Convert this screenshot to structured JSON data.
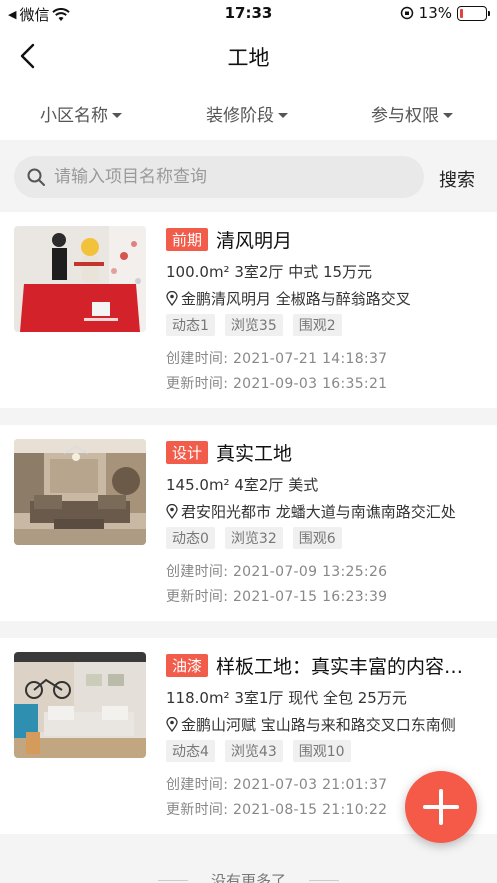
{
  "status_bar": {
    "carrier": "微信",
    "time": "17:33",
    "battery": "13%",
    "battery_level": 0.13
  },
  "nav": {
    "title": "工地"
  },
  "filters": [
    {
      "label": "小区名称"
    },
    {
      "label": "装修阶段"
    },
    {
      "label": "参与权限"
    }
  ],
  "search": {
    "placeholder": "请输入项目名称查询",
    "value": "",
    "button_label": "搜索"
  },
  "projects": [
    {
      "stage": "前期",
      "title": "清风明月",
      "specs": "100.0m² 3室2厅 中式 15万元",
      "address": "金鹏清风明月 全椒路与醉翁路交叉",
      "stats": [
        "动态1",
        "浏览35",
        "围观2"
      ],
      "created": "创建时间: 2021-07-21 14:18:37",
      "updated": "更新时间: 2021-09-03 16:35:21"
    },
    {
      "stage": "设计",
      "title": "真实工地",
      "specs": "145.0m² 4室2厅 美式",
      "address": "君安阳光都市 龙蟠大道与南谯南路交汇处",
      "stats": [
        "动态0",
        "浏览32",
        "围观6"
      ],
      "created": "创建时间: 2021-07-09 13:25:26",
      "updated": "更新时间: 2021-07-15 16:23:39"
    },
    {
      "stage": "油漆",
      "title": "样板工地：真实丰富的内容…",
      "specs": "118.0m² 3室1厅 现代 全包 25万元",
      "address": "金鹏山河赋 宝山路与来和路交叉口东南侧",
      "stats": [
        "动态4",
        "浏览43",
        "围观10"
      ],
      "created": "创建时间: 2021-07-03 21:01:37",
      "updated": "更新时间: 2021-08-15 21:10:22"
    }
  ],
  "footer": {
    "note": "没有更多了"
  },
  "colors": {
    "accent": "#f45a47",
    "tag": "#f25c4a"
  }
}
